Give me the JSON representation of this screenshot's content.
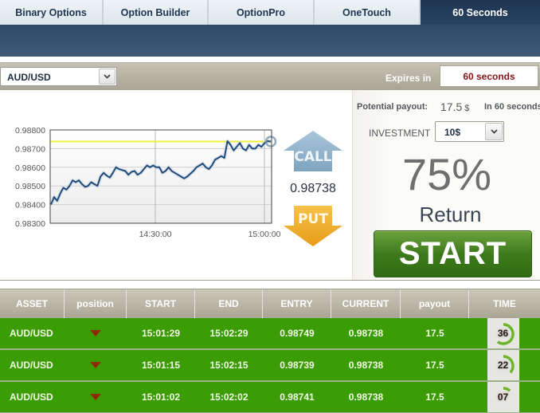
{
  "tabs": [
    {
      "label": "Binary Options",
      "active": false
    },
    {
      "label": "Option Builder",
      "active": false
    },
    {
      "label": "OptionPro",
      "active": false
    },
    {
      "label": "OneTouch",
      "active": false
    },
    {
      "label": "60 Seconds",
      "active": true
    }
  ],
  "toolbar": {
    "asset": "AUD/USD",
    "expires_label": "Expires in",
    "expires_value": "60 seconds"
  },
  "chart": {
    "current_price": "0.98738",
    "call_label": "CALL",
    "put_label": "PUT"
  },
  "chart_data": {
    "type": "line",
    "title": "",
    "xlabel": "",
    "ylabel": "",
    "ylim": [
      0.983,
      0.988
    ],
    "yticks": [
      "0.98800",
      "0.98700",
      "0.98600",
      "0.98500",
      "0.98400",
      "0.98300"
    ],
    "xticks": [
      "14:30:00",
      "15:00:00"
    ],
    "xrange_minutes": [
      14.0,
      15.0
    ],
    "strike_level": 0.98738,
    "grid": true,
    "series": [
      {
        "name": "AUD/USD",
        "values": [
          0.984,
          0.9844,
          0.9842,
          0.9846,
          0.9849,
          0.9848,
          0.985,
          0.9853,
          0.9852,
          0.9853,
          0.9851,
          0.98495,
          0.985,
          0.9852,
          0.9851,
          0.985,
          0.9855,
          0.9857,
          0.98555,
          0.98545,
          0.9857,
          0.986,
          0.9859,
          0.98585,
          0.9858,
          0.9856,
          0.98575,
          0.9858,
          0.9856,
          0.9857,
          0.9859,
          0.9861,
          0.986,
          0.9861,
          0.986,
          0.986,
          0.9857,
          0.9858,
          0.986,
          0.9858,
          0.9857,
          0.9856,
          0.9855,
          0.9854,
          0.9855,
          0.98565,
          0.9858,
          0.986,
          0.9861,
          0.9862,
          0.986,
          0.9859,
          0.9861,
          0.9864,
          0.9865,
          0.9866,
          0.9865,
          0.9874,
          0.9872,
          0.9869,
          0.9871,
          0.9873,
          0.987,
          0.9869,
          0.9872,
          0.987,
          0.987,
          0.9872,
          0.9871,
          0.9873,
          0.9874,
          0.98738
        ]
      }
    ]
  },
  "panel": {
    "payout_label": "Potential payout:",
    "payout_value": "17.5",
    "payout_currency": "$",
    "payout_time": "In 60 seconds",
    "investment_label": "INVESTMENT",
    "investment_value": "10$",
    "return_pct": "75%",
    "return_label": "Return",
    "start_label": "START"
  },
  "table": {
    "headers": [
      "ASSET",
      "position",
      "START",
      "END",
      "ENTRY",
      "CURRENT",
      "payout",
      "TIME"
    ],
    "rows": [
      {
        "asset": "AUD/USD",
        "position": "put",
        "start": "15:01:29",
        "end": "15:02:29",
        "entry": "0.98749",
        "current": "0.98738",
        "payout": "17.5",
        "time": "36",
        "time_fraction": 0.6
      },
      {
        "asset": "AUD/USD",
        "position": "put",
        "start": "15:01:15",
        "end": "15:02:15",
        "entry": "0.98739",
        "current": "0.98738",
        "payout": "17.5",
        "time": "22",
        "time_fraction": 0.37
      },
      {
        "asset": "AUD/USD",
        "position": "put",
        "start": "15:01:02",
        "end": "15:02:02",
        "entry": "0.98741",
        "current": "0.98738",
        "payout": "17.5",
        "time": "07",
        "time_fraction": 0.12
      }
    ]
  },
  "colors": {
    "row_green": "#3c9c05",
    "start_green": "#3e7a1c",
    "expires_red": "#8a1518",
    "strike_yellow": "#f2f23a",
    "line_blue": "#1f4a7a",
    "put_arrow": "#8a2a0a"
  }
}
